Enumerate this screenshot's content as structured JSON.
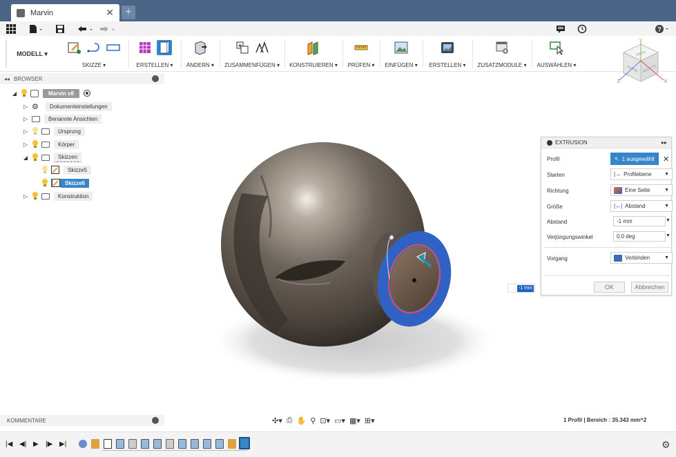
{
  "tab": {
    "title": "Marvin",
    "close": "✕",
    "new": "+"
  },
  "quickbar": {
    "grid_icon": "grid-icon",
    "file_icon": "file-icon",
    "save_icon": "save-icon",
    "undo_icon": "undo-icon",
    "redo_icon": "redo-icon",
    "chat_icon": "chat-icon",
    "clock_icon": "clock-icon",
    "help_icon": "help-icon"
  },
  "ribbon": {
    "mode": "MODELL ▾",
    "groups": [
      {
        "label": "SKIZZE ▾"
      },
      {
        "label": "ERSTELLEN ▾"
      },
      {
        "label": "ÄNDERN ▾"
      },
      {
        "label": "ZUSAMMENFÜGEN ▾"
      },
      {
        "label": "KONSTRUIEREN ▾"
      },
      {
        "label": "PRÜFEN ▾"
      },
      {
        "label": "EINFÜGEN ▾"
      },
      {
        "label": "ERSTELLEN ▾"
      },
      {
        "label": "ZUSATZMODULE ▾"
      },
      {
        "label": "AUSWÄHLEN ▾"
      }
    ]
  },
  "viewcube": {
    "top": "OBEN",
    "front": "VORNE",
    "right": "RECHTS",
    "axis_x": "X",
    "axis_y": "Y",
    "axis_z": "Z"
  },
  "browser": {
    "title": "BROWSER",
    "root": "Marvin v8",
    "items": [
      {
        "label": "Dokumenteinstellungen"
      },
      {
        "label": "Benannte Ansichten"
      },
      {
        "label": "Ursprung"
      },
      {
        "label": "Körper"
      },
      {
        "label": "Skizzen"
      },
      {
        "label": "Skizze5"
      },
      {
        "label": "Skizze6"
      },
      {
        "label": "Konstruktion"
      }
    ]
  },
  "extrusion": {
    "title": "EXTRUSION",
    "rows": {
      "profil": {
        "label": "Profil",
        "value": "1 ausgewählt"
      },
      "starten": {
        "label": "Starten",
        "value": "Profilebene"
      },
      "richtung": {
        "label": "Richtung",
        "value": "Eine Seite"
      },
      "groesse": {
        "label": "Größe",
        "value": "Abstand"
      },
      "abstand": {
        "label": "Abstand",
        "value": "-1 mm"
      },
      "winkel": {
        "label": "Verjüngungswinkel",
        "value": "0.0 deg"
      },
      "vorgang": {
        "label": "Vorgang",
        "value": "Verbinden"
      }
    },
    "ok": "OK",
    "cancel": "Abbrechen"
  },
  "canvas_input": "-1 mm",
  "comments": "KOMMENTARE",
  "status": "1 Profil | Bereich : 35.343 mm^2",
  "colors": {
    "header": "#4a6585",
    "accent": "#3786c9",
    "face_blue": "#2f62c4",
    "body_dark": "#5c554e"
  }
}
